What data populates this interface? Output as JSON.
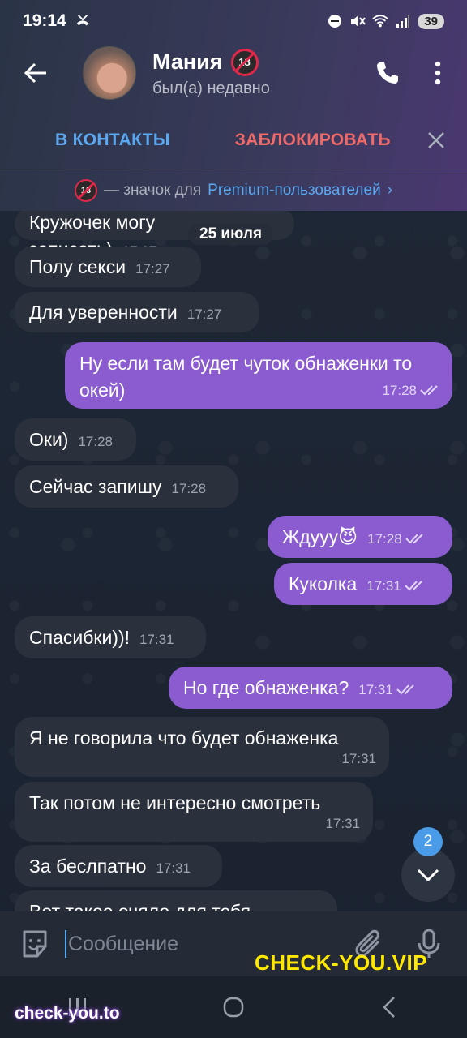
{
  "status_bar": {
    "time": "19:14",
    "battery": "39"
  },
  "header": {
    "contact_name": "Мания",
    "contact_status": "был(а) недавно",
    "badge_text": "18",
    "add_contact_label": "В КОНТАКТЫ",
    "block_label": "ЗАБЛОКИРОВАТЬ",
    "premium_text": "— значок для",
    "premium_link": "Premium-пользователей",
    "premium_chevron": "›"
  },
  "date_pill": "25 июля",
  "messages": [
    {
      "direction": "in",
      "text": "Кружочек могу записать)",
      "time": "17:27"
    },
    {
      "direction": "in",
      "text": "Полу секси",
      "time": "17:27"
    },
    {
      "direction": "in",
      "text": "Для уверенности",
      "time": "17:27"
    },
    {
      "direction": "out",
      "text": "Ну если там будет чуток обнаженки то окей)",
      "time": "17:28",
      "read": true
    },
    {
      "direction": "in",
      "text": "Оки)",
      "time": "17:28"
    },
    {
      "direction": "in",
      "text": "Сейчас запишу",
      "time": "17:28"
    },
    {
      "direction": "out",
      "text": "Ждууу😈",
      "time": "17:28",
      "read": true
    },
    {
      "direction": "out",
      "text": "Куколка",
      "time": "17:31",
      "read": true
    },
    {
      "direction": "in",
      "text": "Спасибки))!",
      "time": "17:31"
    },
    {
      "direction": "out",
      "text": "Но где обнаженка?",
      "time": "17:31",
      "read": true
    },
    {
      "direction": "in",
      "text": "Я не говорила что будет обнаженка",
      "time": "17:31"
    },
    {
      "direction": "in",
      "text": "Так потом не интересно смотреть",
      "time": "17:31"
    },
    {
      "direction": "in",
      "text": "За беслпатно",
      "time": "17:31"
    },
    {
      "direction": "in",
      "text": "Вот такое очяло для тебя",
      "time": ""
    }
  ],
  "scroll_button": {
    "unread_count": "2"
  },
  "input": {
    "placeholder": "Сообщение"
  },
  "watermarks": {
    "main": "CHECK-YOU.VIP",
    "corner": "check-you.to"
  },
  "icons": {
    "back": "arrow-left-icon",
    "call": "phone-icon",
    "menu": "more-vert-icon",
    "close": "close-icon",
    "emoji": "sticker-icon",
    "attach": "paperclip-icon",
    "mic": "microphone-icon",
    "scroll": "chevron-down-icon",
    "read": "double-check-icon"
  },
  "colors": {
    "accent_blue": "#5aa8f0",
    "block_red": "#f06a6a",
    "outgoing_bubble": "#8a5cd0",
    "incoming_bubble": "#2a313c",
    "watermark_yellow": "#ffe800"
  }
}
